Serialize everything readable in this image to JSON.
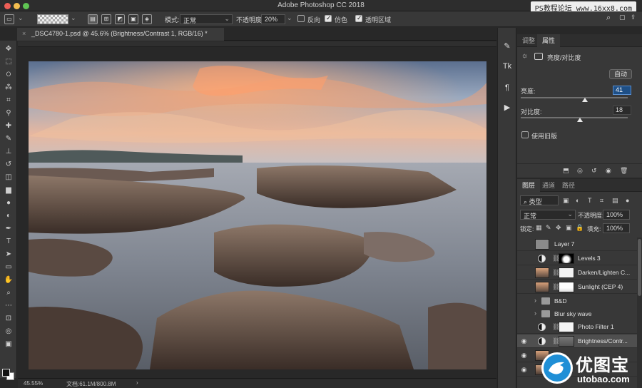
{
  "window": {
    "title": "Adobe Photoshop CC 2018",
    "watermark": "PS教程论坛 www.16xx8.com"
  },
  "options_bar": {
    "mode_label": "模式:",
    "mode_value": "正常",
    "opacity_label": "不透明度:",
    "opacity_value": "20%",
    "reverse_label": "反向",
    "dither_label": "仿色",
    "transparency_label": "透明区域"
  },
  "document": {
    "tab_title": "_DSC4780-1.psd @ 45.6% (Brightness/Contrast 1, RGB/16) *"
  },
  "status": {
    "zoom": "45.55%",
    "doc_size": "文档:61.1M/800.8M"
  },
  "properties_panel": {
    "tabs": [
      "调整",
      "属性"
    ],
    "adjustment_title": "亮度/对比度",
    "auto_label": "自动",
    "brightness_label": "亮度:",
    "brightness_value": "41",
    "contrast_label": "对比度:",
    "contrast_value": "18",
    "legacy_label": "使用旧版",
    "brightness_level": 0.6,
    "contrast_level": 0.55
  },
  "layers_panel": {
    "tabs": [
      "图层",
      "通道",
      "路径"
    ],
    "filter_kind": "类型",
    "blend_mode": "正常",
    "opacity_label": "不透明度:",
    "opacity_value": "100%",
    "lock_label": "锁定:",
    "fill_label": "填充:",
    "fill_value": "100%",
    "layers": [
      {
        "name": "Layer 7",
        "kind": "pixel",
        "visible": false
      },
      {
        "name": "Levels 3",
        "kind": "adjustment",
        "visible": false
      },
      {
        "name": "Darken/Lighten C...",
        "kind": "pixel-mask",
        "visible": false
      },
      {
        "name": "Sunlight (CEP 4)",
        "kind": "pixel-mask",
        "visible": false
      },
      {
        "name": "B&D",
        "kind": "group",
        "visible": false
      },
      {
        "name": "Blur sky wave",
        "kind": "group",
        "visible": false
      },
      {
        "name": "Photo Filter 1",
        "kind": "adjustment",
        "visible": false
      },
      {
        "name": "Brightness/Contr...",
        "kind": "adjustment",
        "visible": true,
        "selected": true
      },
      {
        "name": "",
        "kind": "pixel-mask",
        "visible": true
      },
      {
        "name": "",
        "kind": "pixel-mask",
        "visible": true
      }
    ]
  },
  "watermark_bottom": {
    "text_cn": "优图宝",
    "text_url": "utobao.com"
  },
  "colors": {
    "accent_blue": "#1e4f86",
    "panel_bg": "#383838",
    "app_bg": "#282828"
  }
}
